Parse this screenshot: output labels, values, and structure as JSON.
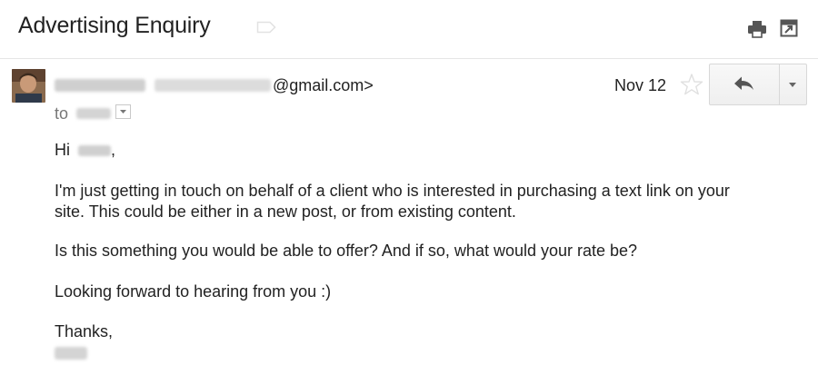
{
  "message": {
    "subject": "Advertising Enquiry",
    "sender_email_suffix": "@gmail.com>",
    "date": "Nov 12",
    "to_label": "to",
    "body": {
      "greeting": "Hi",
      "greeting_punct": ",",
      "paragraph1_line1": "I'm just getting in touch on behalf of a client who is interested in purchasing a text link on your",
      "paragraph1_line2": "site. This could be either in a new post, or from existing content.",
      "paragraph2": "Is this something you would be able to offer? And if so, what would your rate be?",
      "paragraph3": "Looking forward to hearing from you :)",
      "signoff": "Thanks,"
    }
  },
  "icons": {
    "label": "label-tag-icon",
    "print": "print-icon",
    "new_window": "new-window-icon",
    "star": "star-icon",
    "reply": "reply-icon",
    "more": "chevron-down-icon",
    "to_details": "chevron-down-icon"
  },
  "colors": {
    "text": "#222222",
    "muted": "#777777",
    "icon": "#555555",
    "divider": "#e5e5e5",
    "button_border": "#d8d8d8"
  }
}
